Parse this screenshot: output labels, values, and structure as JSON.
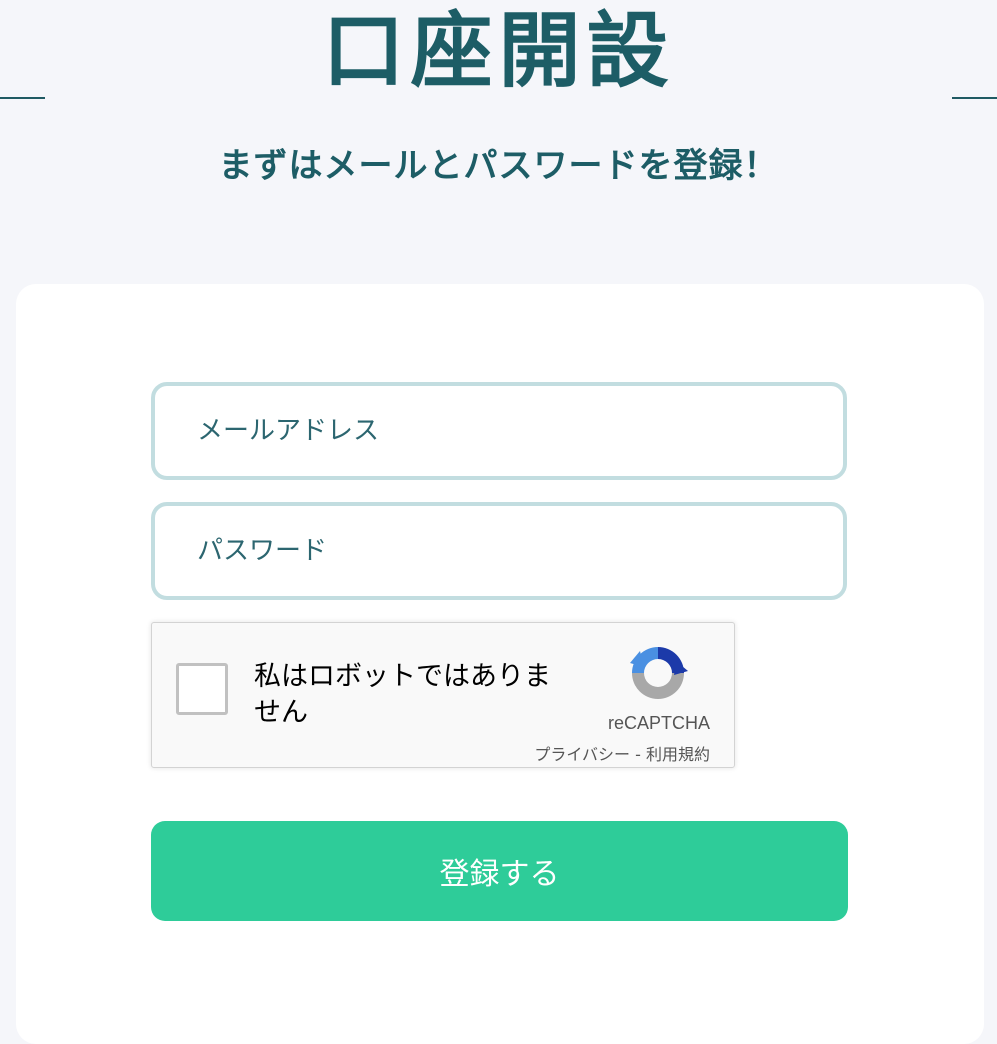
{
  "header": {
    "title": "口座開設",
    "subtitle": "まずはメールとパスワードを登録！"
  },
  "form": {
    "email_placeholder": "メールアドレス",
    "email_value": "",
    "password_placeholder": "パスワード",
    "password_value": "",
    "submit_label": "登録する"
  },
  "captcha": {
    "label": "私はロボットではありません",
    "brand": "reCAPTCHA",
    "privacy_link": "プライバシー",
    "separator": " - ",
    "terms_link": "利用規約",
    "checked": false,
    "logo_icon": "recaptcha-logo-icon"
  },
  "colors": {
    "background": "#f5f6fa",
    "heading": "#1d5d66",
    "field_border": "#c2dde0",
    "accent": "#2ecc99"
  }
}
